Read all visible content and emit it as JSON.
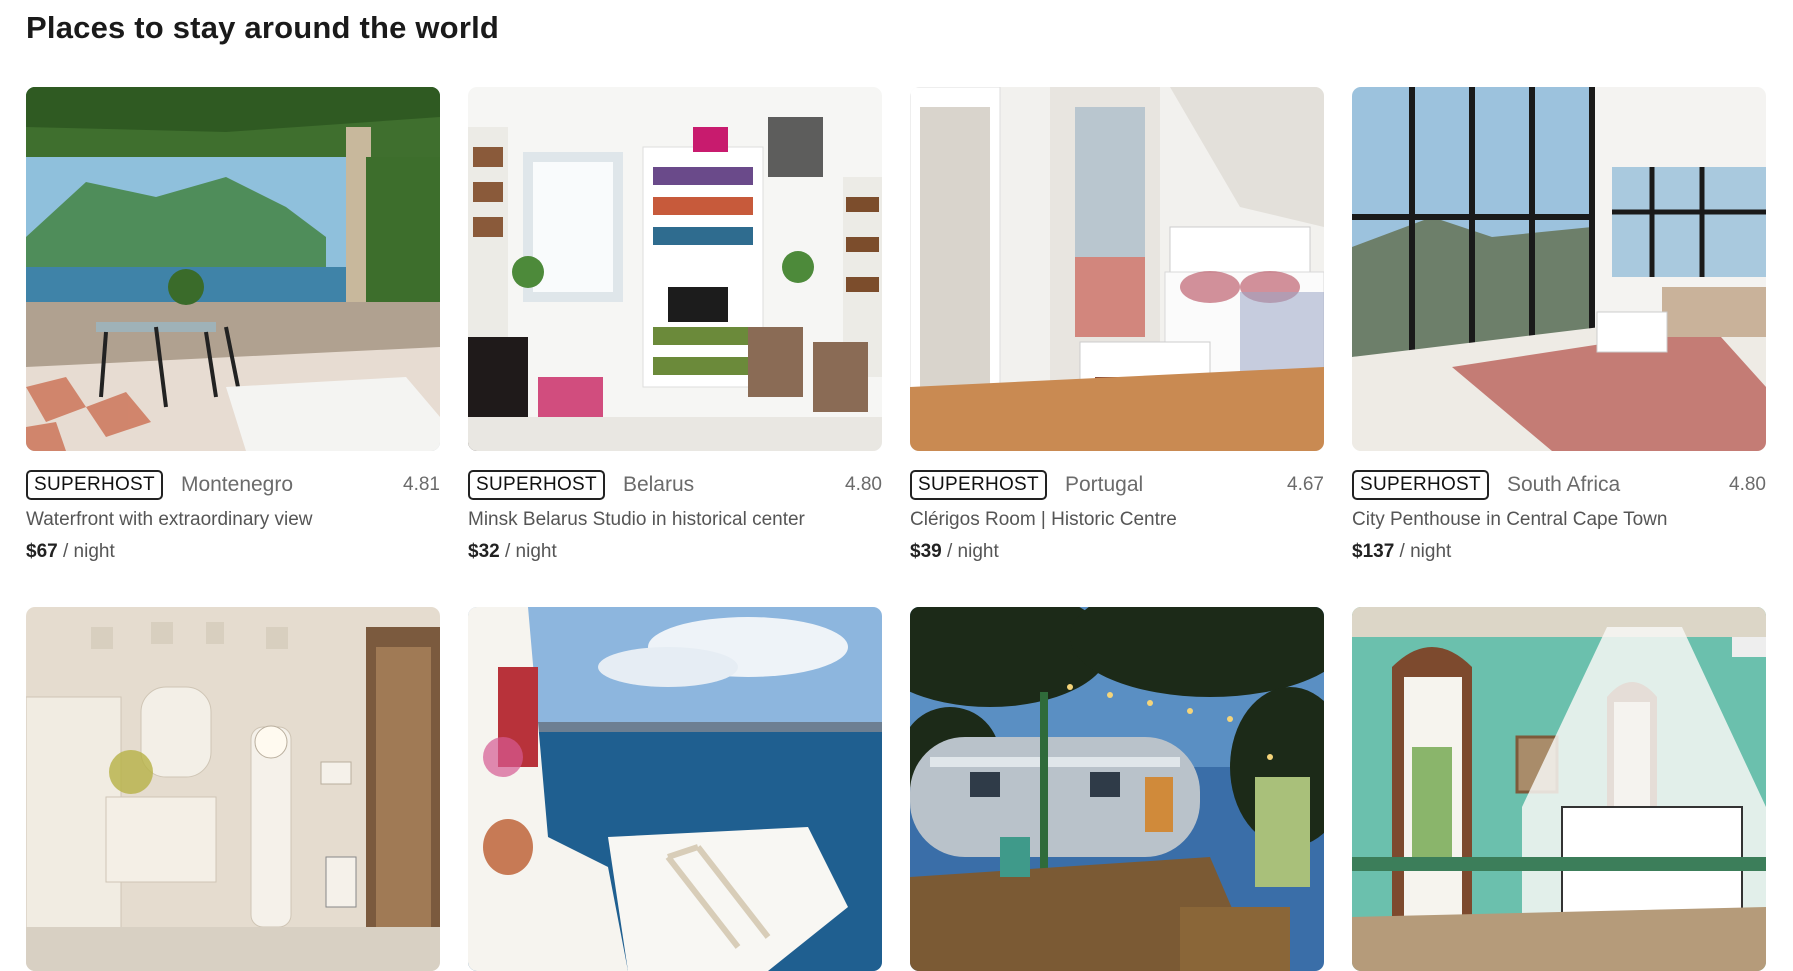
{
  "page": {
    "title": "Places to stay around the world"
  },
  "colors": {
    "text": "#222222",
    "muted": "#6b6b6b",
    "background": "#ffffff"
  },
  "listings": [
    {
      "badge": "SUPERHOST",
      "country": "Montenegro",
      "rating": "4.81",
      "title": "Waterfront with extraordinary view",
      "price": "$67",
      "unit": " / night",
      "image": "terrace-lake-view"
    },
    {
      "badge": "SUPERHOST",
      "country": "Belarus",
      "rating": "4.80",
      "title": "Minsk Belarus Studio in historical center",
      "price": "$32",
      "unit": " / night",
      "image": "white-studio-bookshelves"
    },
    {
      "badge": "SUPERHOST",
      "country": "Portugal",
      "rating": "4.67",
      "title": "Clérigos Room | Historic Centre",
      "price": "$39",
      "unit": " / night",
      "image": "white-bedroom-balcony"
    },
    {
      "badge": "SUPERHOST",
      "country": "South Africa",
      "rating": "4.80",
      "title": "City Penthouse in Central Cape Town",
      "price": "$137",
      "unit": " / night",
      "image": "penthouse-glass-walls"
    },
    {
      "image": "vintage-white-room"
    },
    {
      "image": "santorini-sea-terrace"
    },
    {
      "image": "airstream-trailer-camp"
    },
    {
      "image": "green-canopy-bedroom"
    }
  ]
}
